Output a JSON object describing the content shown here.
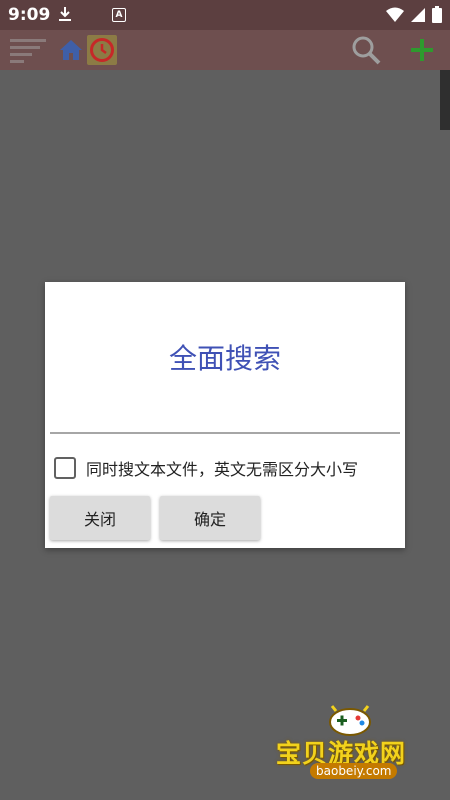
{
  "status_bar": {
    "time": "9:09",
    "icons": [
      "download-icon",
      "a-icon",
      "wifi-icon",
      "signal-icon",
      "battery-icon"
    ],
    "a_icon_text": "A"
  },
  "toolbar": {
    "icons": [
      "menu-icon",
      "home-icon",
      "history-clock-icon",
      "search-icon",
      "add-icon"
    ],
    "colors": {
      "home": "#3f5fa8",
      "clock": "#c62828",
      "add": "#2e9a2e",
      "search": "#9e9e9e"
    }
  },
  "dialog": {
    "title": "全面搜索",
    "search_value": "",
    "checkbox_label": "同时搜文本文件，英文无需区分大小写",
    "checkbox_checked": false,
    "close_label": "关闭",
    "ok_label": "确定",
    "accent": "#3f51b5"
  },
  "watermark": {
    "text": "宝贝游戏网",
    "url": "baobeiy.com"
  }
}
